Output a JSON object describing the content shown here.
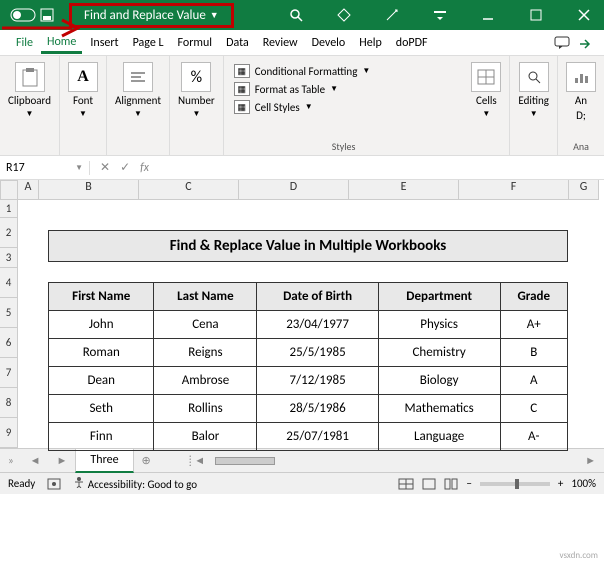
{
  "titlebar": {
    "document_title": "Find and Replace Value"
  },
  "ribbon_tabs": {
    "file": "File",
    "home": "Home",
    "insert": "Insert",
    "page": "Page L",
    "formulas": "Formul",
    "data": "Data",
    "review": "Review",
    "develo": "Develo",
    "help": "Help",
    "dopdf": "doPDF"
  },
  "ribbon": {
    "clipboard": "Clipboard",
    "font": "Font",
    "alignment": "Alignment",
    "number": "Number",
    "cond_fmt": "Conditional Formatting",
    "as_table": "Format as Table",
    "cell_styles": "Cell Styles",
    "styles": "Styles",
    "cells": "Cells",
    "editing": "Editing",
    "analyze": "An",
    "analyze2": "D;",
    "analyze_label": "Ana"
  },
  "namebox": "R17",
  "fx_label": "fx",
  "columns": [
    "A",
    "B",
    "C",
    "D",
    "E",
    "F",
    "G"
  ],
  "rows": [
    "1",
    "2",
    "3",
    "4",
    "5",
    "6",
    "7",
    "8",
    "9"
  ],
  "sheet_title": "Find & Replace Value in Multiple Workbooks",
  "table": {
    "headers": [
      "First Name",
      "Last Name",
      "Date of Birth",
      "Department",
      "Grade"
    ],
    "rows": [
      [
        "John",
        "Cena",
        "23/04/1977",
        "Physics",
        "A+"
      ],
      [
        "Roman",
        "Reigns",
        "25/5/1985",
        "Chemistry",
        "B"
      ],
      [
        "Dean",
        "Ambrose",
        "7/12/1985",
        "Biology",
        "A"
      ],
      [
        "Seth",
        "Rollins",
        "28/5/1986",
        "Mathematics",
        "C"
      ],
      [
        "Finn",
        "Balor",
        "25/07/1981",
        "Language",
        "A-"
      ]
    ]
  },
  "sheet_tab": "Three",
  "statusbar": {
    "ready": "Ready",
    "accessibility": "Accessibility: Good to go",
    "zoom": "100%"
  },
  "watermark": "vsxdn.com"
}
